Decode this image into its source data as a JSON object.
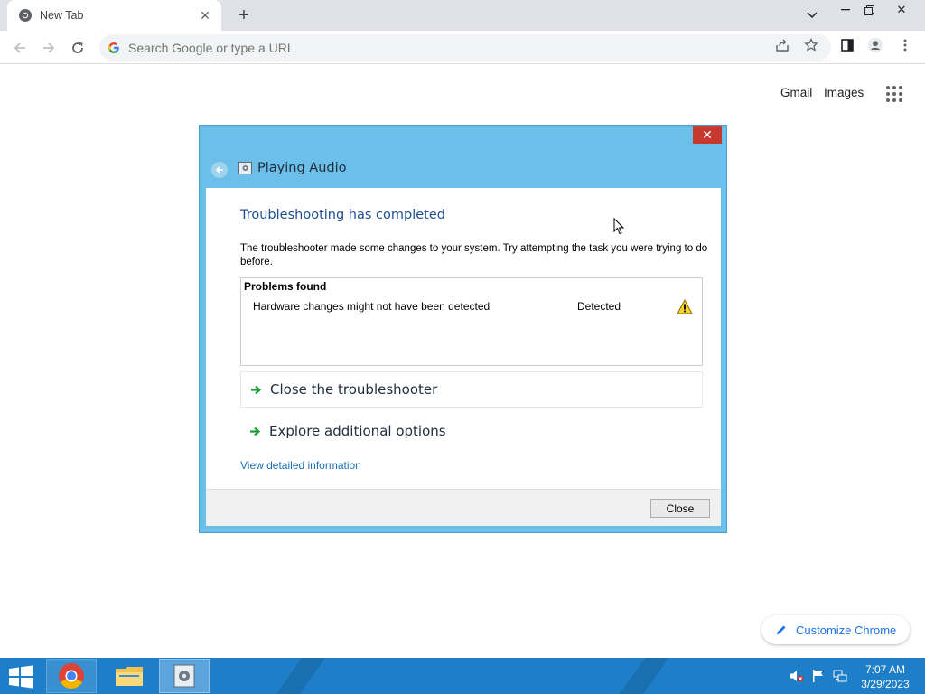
{
  "browser": {
    "tab_title": "New Tab",
    "omnibox_placeholder": "Search Google or type a URL",
    "window_controls": [
      "chevron-down",
      "minimize",
      "restore",
      "close"
    ]
  },
  "ntp": {
    "gmail_label": "Gmail",
    "images_label": "Images",
    "customize_label": "Customize Chrome"
  },
  "dialog": {
    "title": "Playing Audio",
    "heading": "Troubleshooting has completed",
    "description": "The troubleshooter made some changes to your system. Try attempting the task you were trying to do before.",
    "problems_header": "Problems found",
    "problems": [
      {
        "name": "Hardware changes might not have been detected",
        "status": "Detected",
        "icon": "warning-icon"
      }
    ],
    "options": [
      {
        "label": "Close the troubleshooter"
      },
      {
        "label": "Explore additional options"
      }
    ],
    "detail_link": "View detailed information",
    "close_button": "Close"
  },
  "taskbar": {
    "items": [
      "start",
      "chrome",
      "file-explorer",
      "troubleshooter"
    ],
    "time": "7:07 AM",
    "date": "3/29/2023"
  },
  "colors": {
    "dialog_frame": "#6bbfe8",
    "heading_blue": "#1c4f91",
    "link_blue": "#1f6fb6",
    "taskbar": "#1e7ec8",
    "close_red": "#c7392f"
  }
}
